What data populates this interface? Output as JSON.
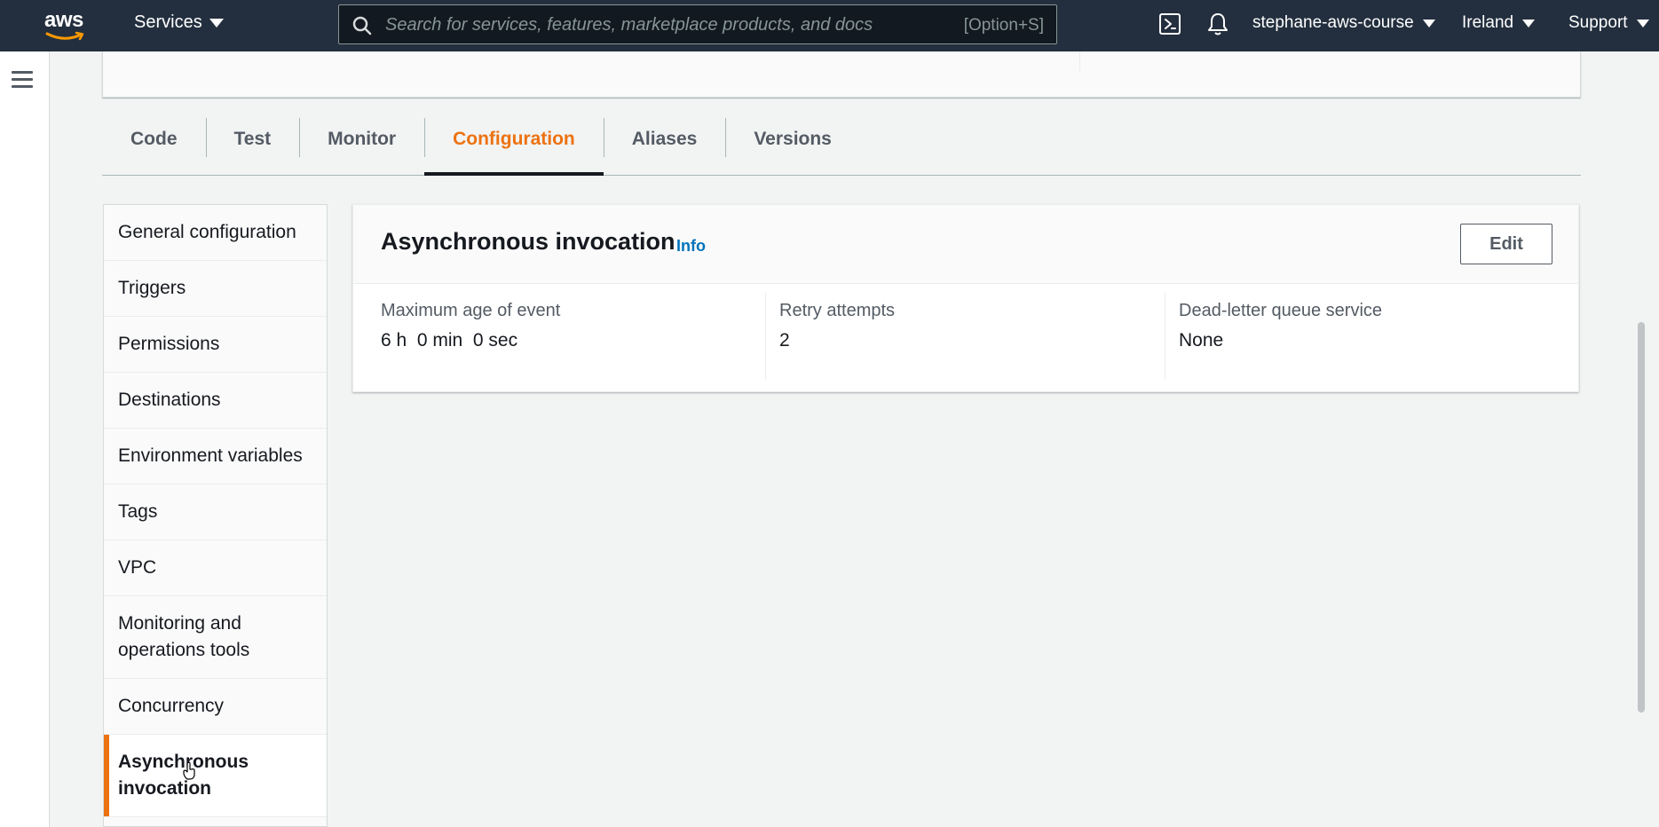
{
  "topnav": {
    "logo": "aws",
    "services_label": "Services",
    "search_placeholder": "Search for services, features, marketplace products, and docs",
    "search_shortcut": "[Option+S]",
    "account": "stephane-aws-course",
    "region": "Ireland",
    "support": "Support",
    "icons": [
      "cloudshell-icon",
      "bell-icon"
    ]
  },
  "tabs": [
    {
      "label": "Code"
    },
    {
      "label": "Test"
    },
    {
      "label": "Monitor"
    },
    {
      "label": "Configuration",
      "active": true
    },
    {
      "label": "Aliases"
    },
    {
      "label": "Versions"
    }
  ],
  "side_menu": {
    "items": [
      {
        "label": "General configuration"
      },
      {
        "label": "Triggers"
      },
      {
        "label": "Permissions"
      },
      {
        "label": "Destinations"
      },
      {
        "label": "Environment variables"
      },
      {
        "label": "Tags"
      },
      {
        "label": "VPC"
      },
      {
        "label": "Monitoring and operations tools"
      },
      {
        "label": "Concurrency"
      },
      {
        "label": "Asynchronous invocation",
        "active": true
      }
    ]
  },
  "card": {
    "title": "Asynchronous invocation",
    "info": "Info",
    "edit_label": "Edit",
    "fields": [
      {
        "label": "Maximum age of event",
        "value": "6 h  0 min  0 sec"
      },
      {
        "label": "Retry attempts",
        "value": "2"
      },
      {
        "label": "Dead-letter queue service",
        "value": "None"
      }
    ]
  },
  "colors": {
    "nav_bg": "#232f3e",
    "accent": "#ec7211",
    "link": "#0073bb"
  }
}
